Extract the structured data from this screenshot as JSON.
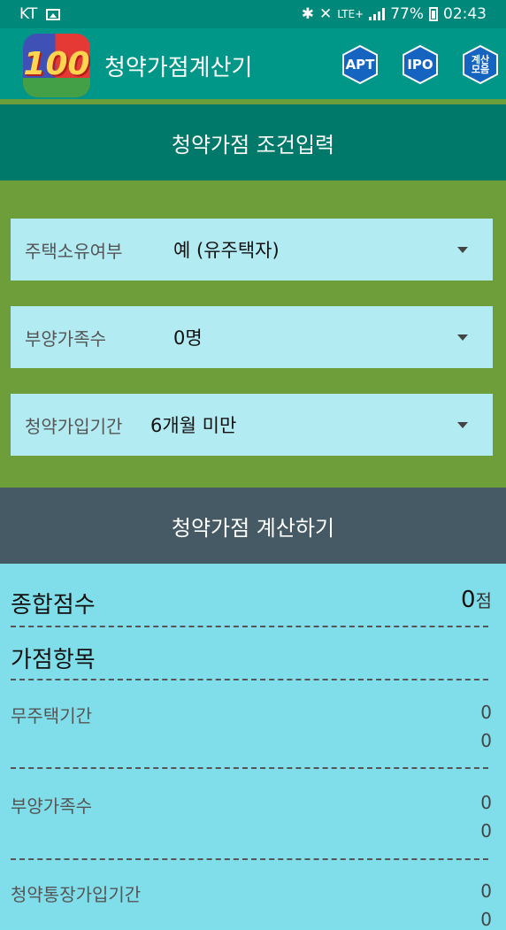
{
  "status": {
    "carrier": "KT",
    "battery": "77%",
    "time": "02:43",
    "network": "LTE+"
  },
  "app": {
    "title": "청약가점계산기",
    "logo_text": "100"
  },
  "actions": [
    {
      "label": "APT"
    },
    {
      "label": "IPO"
    },
    {
      "label": "계산모음"
    }
  ],
  "section": {
    "title": "청약가점 조건입력"
  },
  "fields": [
    {
      "label": "주택소유여부",
      "value": "예 (유주택자)"
    },
    {
      "label": "부양가족수",
      "value": "0명"
    },
    {
      "label": "청약가입기간",
      "value": "6개월 미만"
    }
  ],
  "calculate": {
    "label": "청약가점 계산하기"
  },
  "results": {
    "total_label": "종합점수",
    "total_value": "0",
    "total_unit": "점",
    "items_header": "가점항목",
    "items": [
      {
        "label": "무주택기간",
        "value1": "0",
        "value2": "0"
      },
      {
        "label": "부양가족수",
        "value1": "0",
        "value2": "0"
      },
      {
        "label": "청약통장가입기간",
        "value1": "0",
        "value2": "0"
      }
    ]
  },
  "colors": {
    "appbar": "#009688",
    "form_bg": "#6d9e3a",
    "calc_button": "#455a64",
    "results_bg": "#80deea"
  }
}
